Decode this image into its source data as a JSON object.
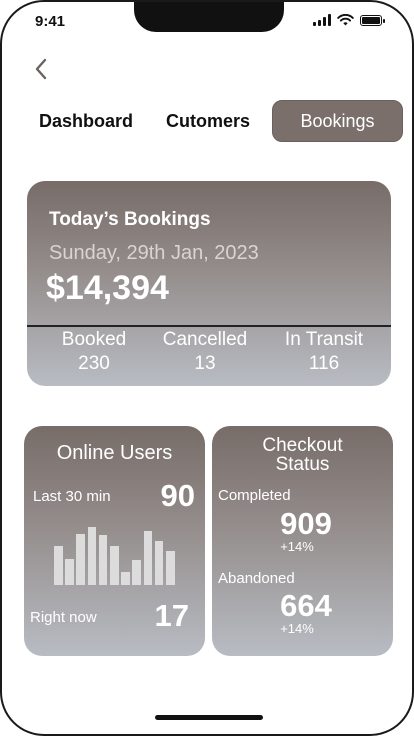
{
  "status_bar": {
    "time": "9:41",
    "icons": [
      "cellular-signal-icon",
      "wifi-icon",
      "battery-icon"
    ]
  },
  "nav": {
    "back_icon": "chevron-left-icon"
  },
  "tabs": [
    {
      "label": "Dashboard",
      "active": false
    },
    {
      "label": "Cutomers",
      "active": false
    },
    {
      "label": "Bookings",
      "active": true
    }
  ],
  "bookings_card": {
    "title": "Today’s Bookings",
    "date": "Sunday, 29th Jan, 2023",
    "amount": "$14,394",
    "stats": [
      {
        "label": "Booked",
        "value": "230"
      },
      {
        "label": "Cancelled",
        "value": "13"
      },
      {
        "label": "In Transit",
        "value": "116"
      }
    ]
  },
  "online_users_card": {
    "title": "Online Users",
    "last_30_label": "Last 30 min",
    "last_30_value": "90",
    "right_now_label": "Right now",
    "right_now_value": "17",
    "sparkline_values": [
      38,
      26,
      50,
      57,
      49,
      38,
      13,
      25,
      53,
      43,
      33
    ]
  },
  "checkout_card": {
    "title_line1": "Checkout",
    "title_line2": "Status",
    "completed_label": "Completed",
    "completed_value": "909",
    "completed_change": "+14%",
    "abandoned_label": "Abandoned",
    "abandoned_value": "664",
    "abandoned_change": "+14%"
  },
  "colors": {
    "card_top": "#776c68",
    "card_bottom": "#b8bcc3",
    "active_tab": "#7a6f6b"
  }
}
